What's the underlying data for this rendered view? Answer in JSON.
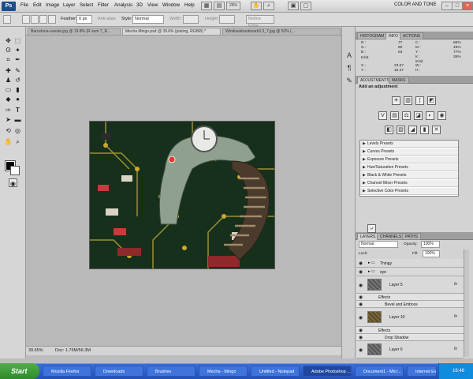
{
  "menubar": {
    "logo": "Ps",
    "items": [
      "File",
      "Edit",
      "Image",
      "Layer",
      "Select",
      "Filter",
      "Analysis",
      "3D",
      "View",
      "Window",
      "Help"
    ],
    "zoom_field": "25%",
    "workspace": "COLOR AND TONE",
    "colors": {
      "logo_bg": "#1c4e8c"
    }
  },
  "options": {
    "feather_label": "Feather:",
    "feather_value": "0 px",
    "antialias_label": "Anti-alias",
    "style_label": "Style:",
    "style_value": "Normal",
    "width_label": "Width:",
    "height_label": "Height:",
    "refine_label": "Refine Edge..."
  },
  "doc_tabs": [
    "Barcelona-sueste.jpg @ 19.8% (R sem 7_R...",
    "Mecha Mingo.psd @ 39.6% (plating, RGB/8) *",
    "Windowsbookmark3.3_7.jpg @ 50% (..."
  ],
  "status": {
    "zoom": "39.65%",
    "doc": "Doc: 1.76M/56.3M"
  },
  "info_panel": {
    "tabs": [
      "HISTOGRAM",
      "INFO",
      "ACTIONS"
    ],
    "left": [
      "R :",
      "G :",
      "B :",
      "8-bit",
      "X :",
      "Y :"
    ],
    "left_vals": [
      "77",
      "90",
      "63",
      "",
      "23.67",
      "16.37"
    ],
    "right": [
      "C :",
      "M :",
      "Y :",
      "K :",
      "8-bit",
      "W :",
      "H :"
    ],
    "right_vals": [
      "66%",
      "46%",
      "77%",
      "35%",
      "",
      ""
    ]
  },
  "adjustments": {
    "tabs": [
      "ADJUSTMENTS",
      "MASKS"
    ],
    "title": "Add an adjustment",
    "presets": [
      "Levels Presets",
      "Curves Presets",
      "Exposure Presets",
      "Hue/Saturation Presets",
      "Black & White Presets",
      "Channel Mixer Presets",
      "Selective Color Presets"
    ]
  },
  "layers": {
    "tabs": [
      "LAYERS",
      "CHANNELS",
      "PATHS"
    ],
    "blend_mode": "Normal",
    "opacity_label": "Opacity:",
    "opacity_value": "100%",
    "lock_label": "Lock:",
    "fill_label": "Fill:",
    "fill_value": "100%",
    "groups": [
      "Thingy",
      "eye"
    ],
    "items": [
      {
        "name": "Layer 5",
        "effects_label": "Effects",
        "effect": "Bevel and Emboss"
      },
      {
        "name": "Layer 10",
        "effects_label": "Effects",
        "effect": "Drop Shadow"
      },
      {
        "name": "Layer 6"
      }
    ],
    "fx": "fx"
  },
  "taskbar": {
    "start": "Start",
    "tasks": [
      "Mozilla Firefox",
      "Downloads",
      "Brushes",
      "Mecha - Mingo",
      "Untitled - Notepad",
      "Adobe Photoshop ...",
      "Document1 - Micr...",
      "Internet Explorer"
    ],
    "clock": "16:46"
  }
}
